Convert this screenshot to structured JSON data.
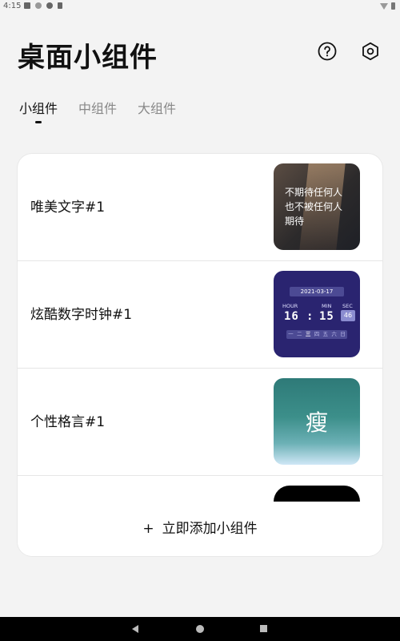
{
  "status_bar": {
    "time": "4:15"
  },
  "header": {
    "title": "桌面小组件",
    "help_icon": "question-circle-icon",
    "settings_icon": "hexagon-gear-icon"
  },
  "tabs": [
    {
      "label": "小组件",
      "active": true
    },
    {
      "label": "中组件",
      "active": false
    },
    {
      "label": "大组件",
      "active": false
    }
  ],
  "widgets": [
    {
      "label": "唯美文字#1",
      "preview_text": [
        "不期待任何人",
        "也不被任何人",
        "期待"
      ]
    },
    {
      "label": "炫酷数字时钟#1",
      "clock": {
        "date": "2021-03-17",
        "hour_label": "HOUR",
        "min_label": "MIN",
        "sec_label": "SEC",
        "hour": "16",
        "minute": "15",
        "separator": ":",
        "second": "46",
        "weekdays": [
          "一",
          "二",
          "三",
          "四",
          "五",
          "六",
          "日"
        ]
      }
    },
    {
      "label": "个性格言#1",
      "preview_char": "瘦"
    },
    {
      "label": ""
    }
  ],
  "add_button": {
    "plus": "+",
    "label": "立即添加小组件"
  },
  "colors": {
    "accent": "#111111",
    "background": "#f3f3f3",
    "card": "#ffffff",
    "clock_bg": "#2a2470"
  }
}
